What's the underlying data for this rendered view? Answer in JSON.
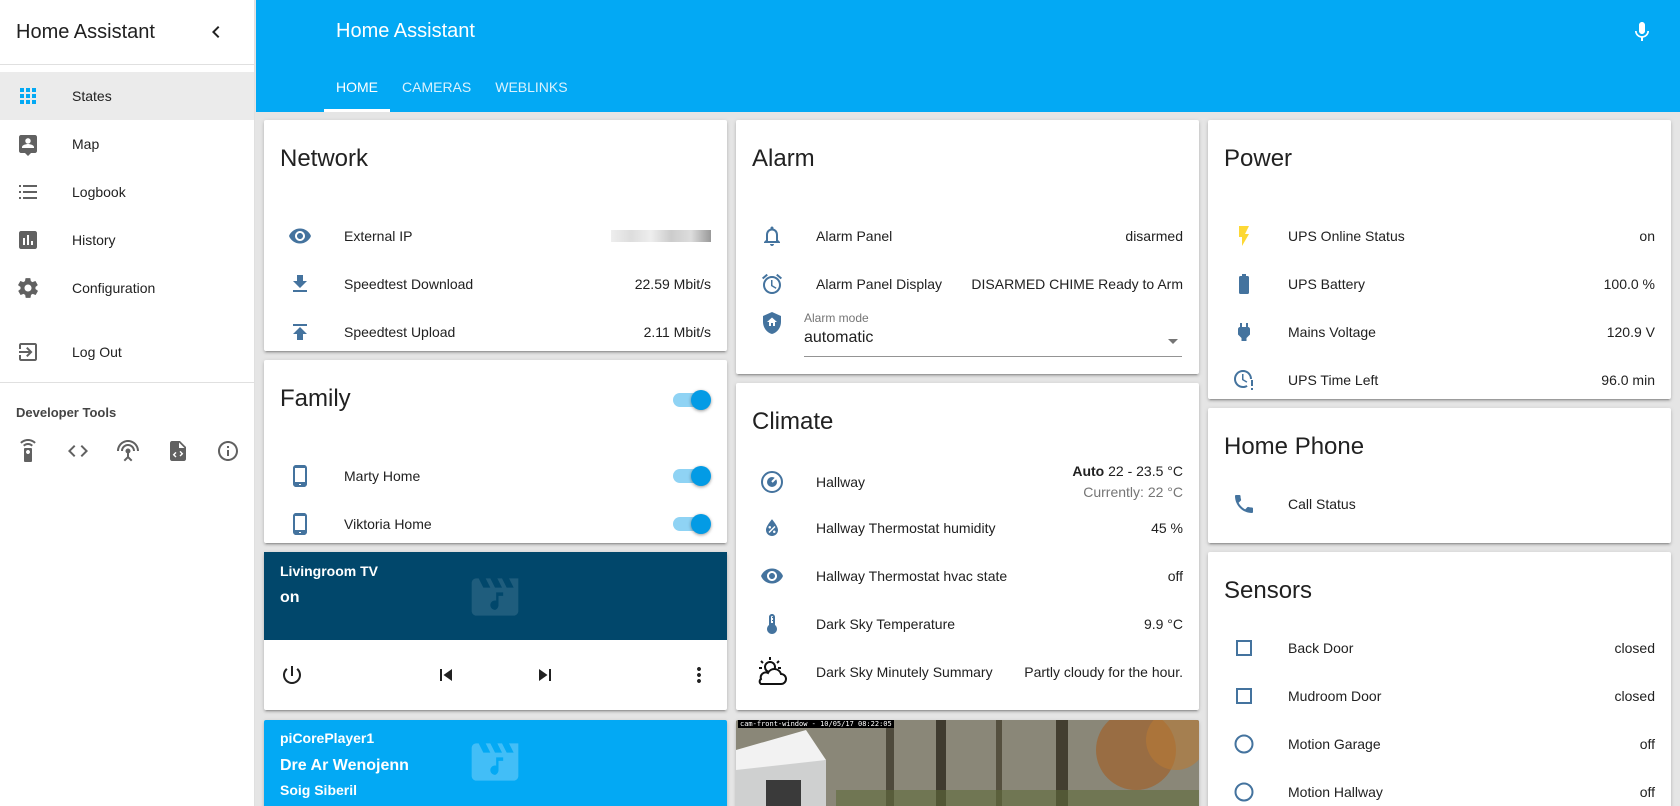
{
  "sidebar": {
    "title": "Home Assistant",
    "items": [
      {
        "label": "States",
        "icon": "apps-grid-icon"
      },
      {
        "label": "Map",
        "icon": "account-box-icon"
      },
      {
        "label": "Logbook",
        "icon": "list-icon"
      },
      {
        "label": "History",
        "icon": "chart-box-icon"
      },
      {
        "label": "Configuration",
        "icon": "gear-icon"
      }
    ],
    "logout_label": "Log Out",
    "dev_tools_title": "Developer Tools",
    "dev_tools_icons": [
      "remote-icon",
      "code-icon",
      "antenna-icon",
      "file-code-icon",
      "info-icon"
    ]
  },
  "topbar": {
    "title": "Home Assistant",
    "tabs": [
      "HOME",
      "CAMERAS",
      "WEBLINKS"
    ],
    "accent": "#03a9f4"
  },
  "network": {
    "title": "Network",
    "rows": [
      {
        "name": "External IP",
        "value": ""
      },
      {
        "name": "Speedtest Download",
        "value": "22.59 Mbit/s"
      },
      {
        "name": "Speedtest Upload",
        "value": "2.11 Mbit/s"
      }
    ]
  },
  "family": {
    "title": "Family",
    "rows": [
      {
        "name": "Marty Home"
      },
      {
        "name": "Viktoria Home"
      }
    ]
  },
  "livingroom_tv": {
    "name": "Livingroom TV",
    "state": "on"
  },
  "picoreplayer": {
    "name": "piCorePlayer1",
    "track": "Dre Ar Wenojenn",
    "artist": "Soig Siberil"
  },
  "alarm": {
    "title": "Alarm",
    "rows": [
      {
        "name": "Alarm Panel",
        "value": "disarmed"
      },
      {
        "name": "Alarm Panel Display",
        "value": "DISARMED CHIME Ready to Arm"
      }
    ],
    "mode_label": "Alarm mode",
    "mode_value": "automatic"
  },
  "climate": {
    "title": "Climate",
    "hallway": {
      "name": "Hallway",
      "mode": "Auto",
      "range": "22 - 23.5 °C",
      "current": "Currently: 22 °C"
    },
    "rows": [
      {
        "name": "Hallway Thermostat humidity",
        "value": "45 %"
      },
      {
        "name": "Hallway Thermostat hvac state",
        "value": "off"
      },
      {
        "name": "Dark Sky Temperature",
        "value": "9.9 °C"
      },
      {
        "name": "Dark Sky Minutely Summary",
        "value": "Partly cloudy for the hour."
      }
    ]
  },
  "camera": {
    "stamp": "cam-front-window - 10/05/17 08:22:05"
  },
  "power": {
    "title": "Power",
    "rows": [
      {
        "name": "UPS Online Status",
        "value": "on"
      },
      {
        "name": "UPS Battery",
        "value": "100.0 %"
      },
      {
        "name": "Mains Voltage",
        "value": "120.9 V"
      },
      {
        "name": "UPS Time Left",
        "value": "96.0 min"
      }
    ]
  },
  "home_phone": {
    "title": "Home Phone",
    "rows": [
      {
        "name": "Call Status",
        "value": ""
      }
    ]
  },
  "sensors": {
    "title": "Sensors",
    "rows": [
      {
        "name": "Back Door",
        "value": "closed"
      },
      {
        "name": "Mudroom Door",
        "value": "closed"
      },
      {
        "name": "Motion Garage",
        "value": "off"
      },
      {
        "name": "Motion Hallway",
        "value": "off"
      }
    ]
  },
  "colors": {
    "icon": "#44739e",
    "lightning": "#fdd835",
    "tv_bg": "#01476b"
  }
}
